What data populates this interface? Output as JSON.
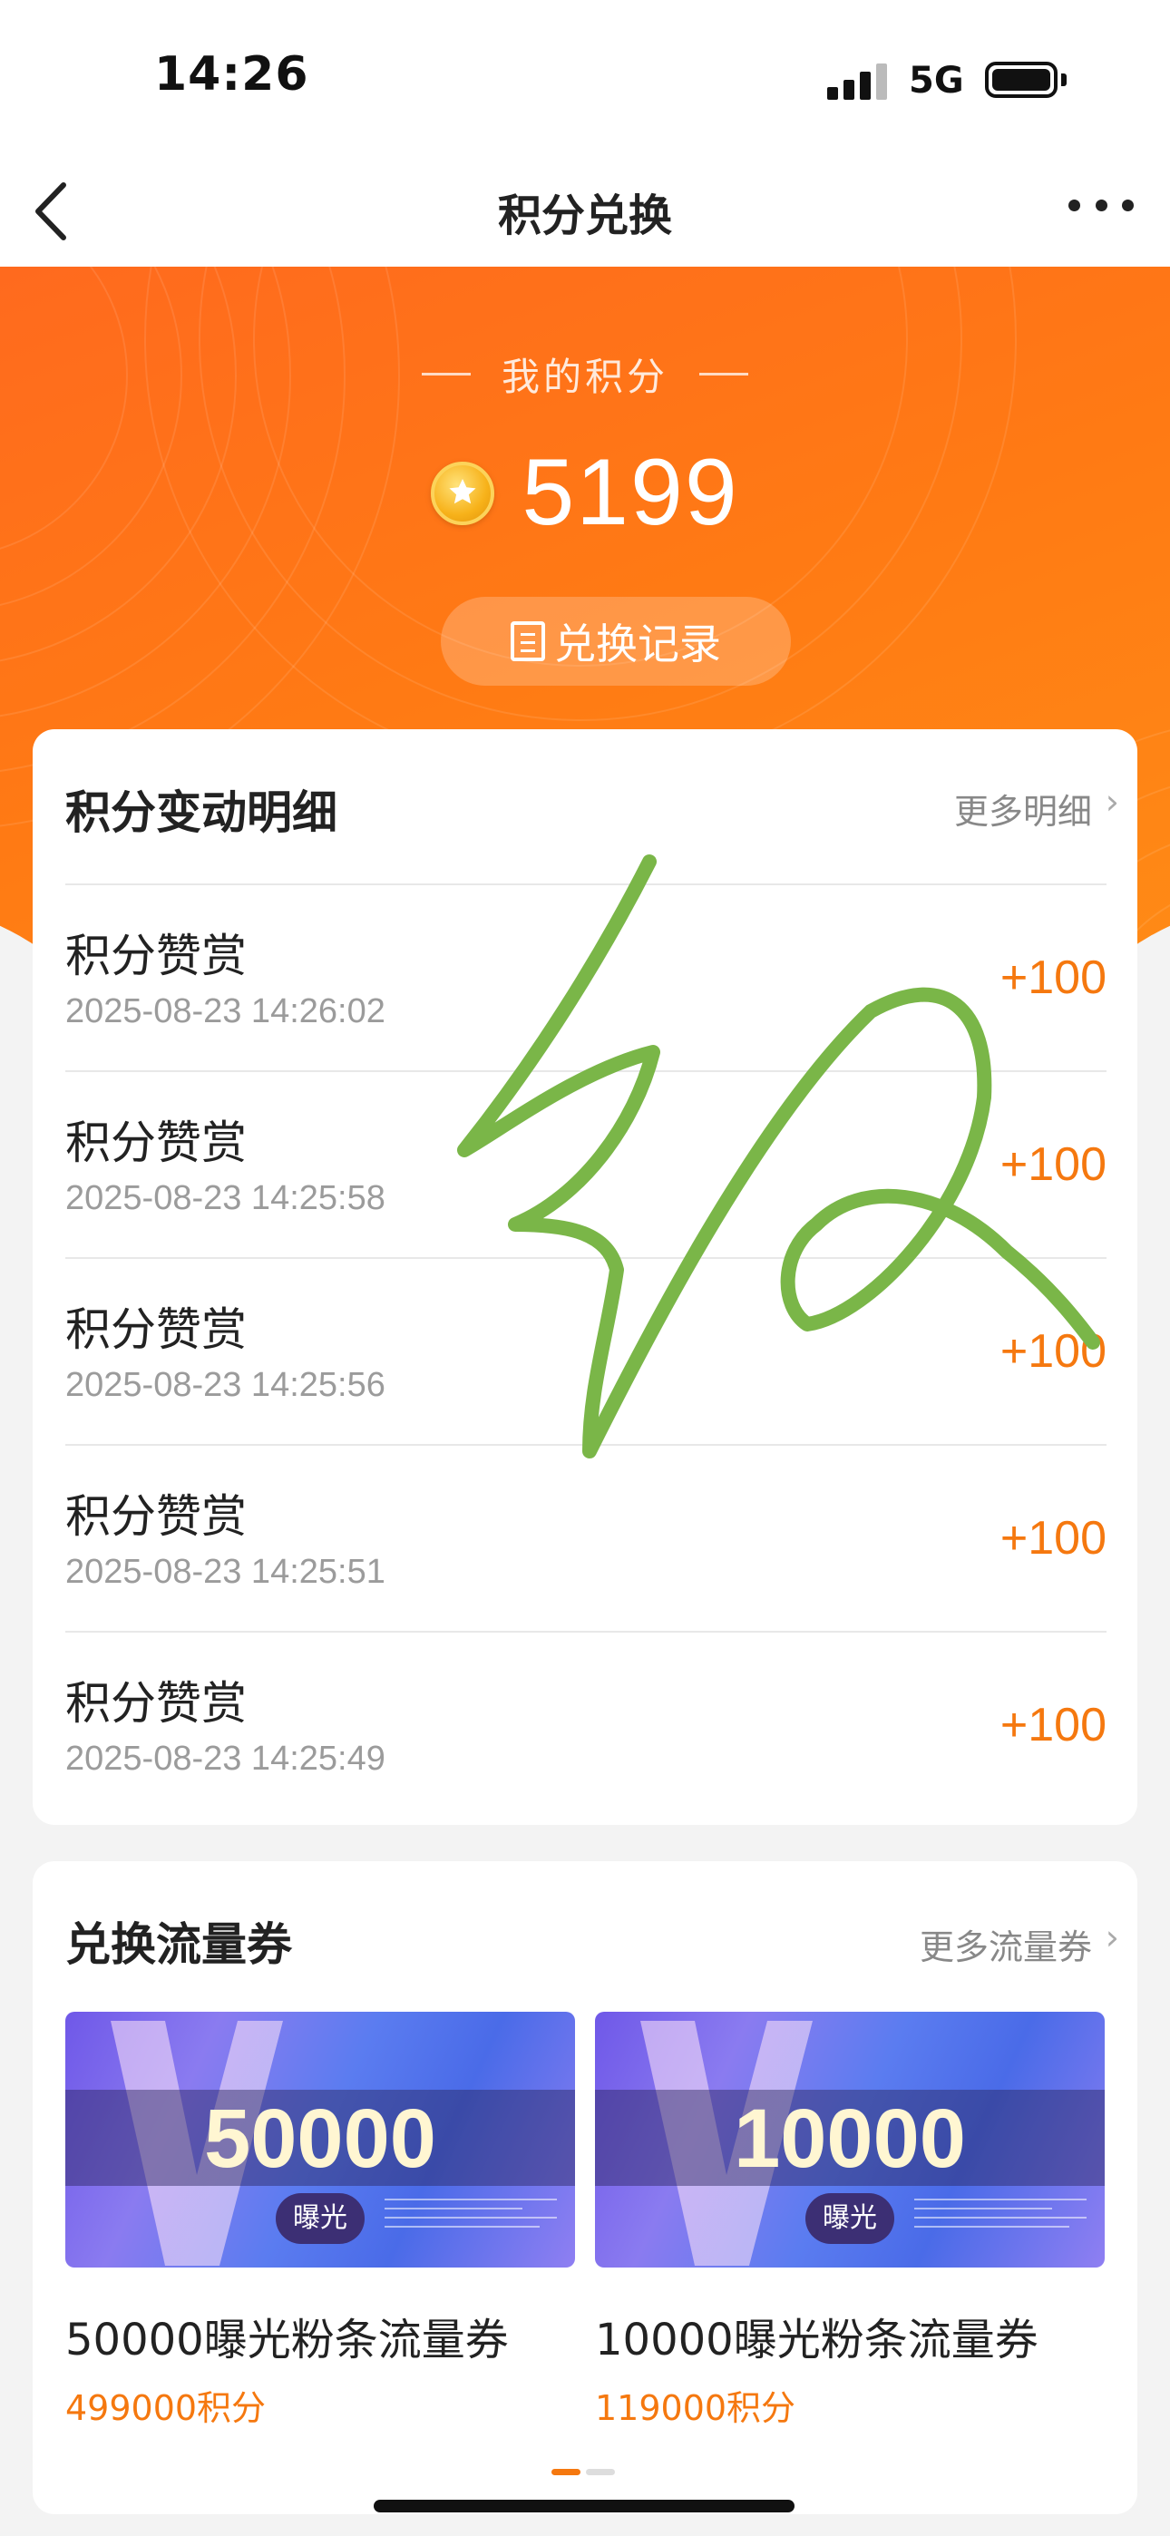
{
  "status_bar": {
    "time": "14:26",
    "network": "5G",
    "icons": [
      "signal-icon",
      "battery-icon"
    ]
  },
  "nav": {
    "title": "积分兑换",
    "back_icon": "back-arrow-icon",
    "more_icon": "more-icon"
  },
  "hero": {
    "label": "我的积分",
    "points": "5199",
    "coin_icon": "coin-star-icon",
    "record_button_label": "兑换记录",
    "record_button_icon": "list-icon",
    "colors": {
      "gradient_start": "#ff6a1e",
      "gradient_end": "#ff8f16"
    }
  },
  "records": {
    "title": "积分变动明细",
    "more_label": "更多明细",
    "items": [
      {
        "name": "积分赞赏",
        "time": "2025-08-23 14:26:02",
        "amount": "+100"
      },
      {
        "name": "积分赞赏",
        "time": "2025-08-23 14:25:58",
        "amount": "+100"
      },
      {
        "name": "积分赞赏",
        "time": "2025-08-23 14:25:56",
        "amount": "+100"
      },
      {
        "name": "积分赞赏",
        "time": "2025-08-23 14:25:51",
        "amount": "+100"
      },
      {
        "name": "积分赞赏",
        "time": "2025-08-23 14:25:49",
        "amount": "+100"
      }
    ]
  },
  "coupons": {
    "title": "兑换流量券",
    "more_label": "更多流量券",
    "items": [
      {
        "amount": "50000",
        "tag": "曝光",
        "name": "50000曝光粉条流量券",
        "cost": "499000积分"
      },
      {
        "amount": "10000",
        "tag": "曝光",
        "name": "10000曝光粉条流量券",
        "cost": "119000积分"
      }
    ],
    "pager": {
      "pages": 2,
      "current": 1
    }
  },
  "accent_color": "#f5780f",
  "scribble_color": "#7ab648"
}
